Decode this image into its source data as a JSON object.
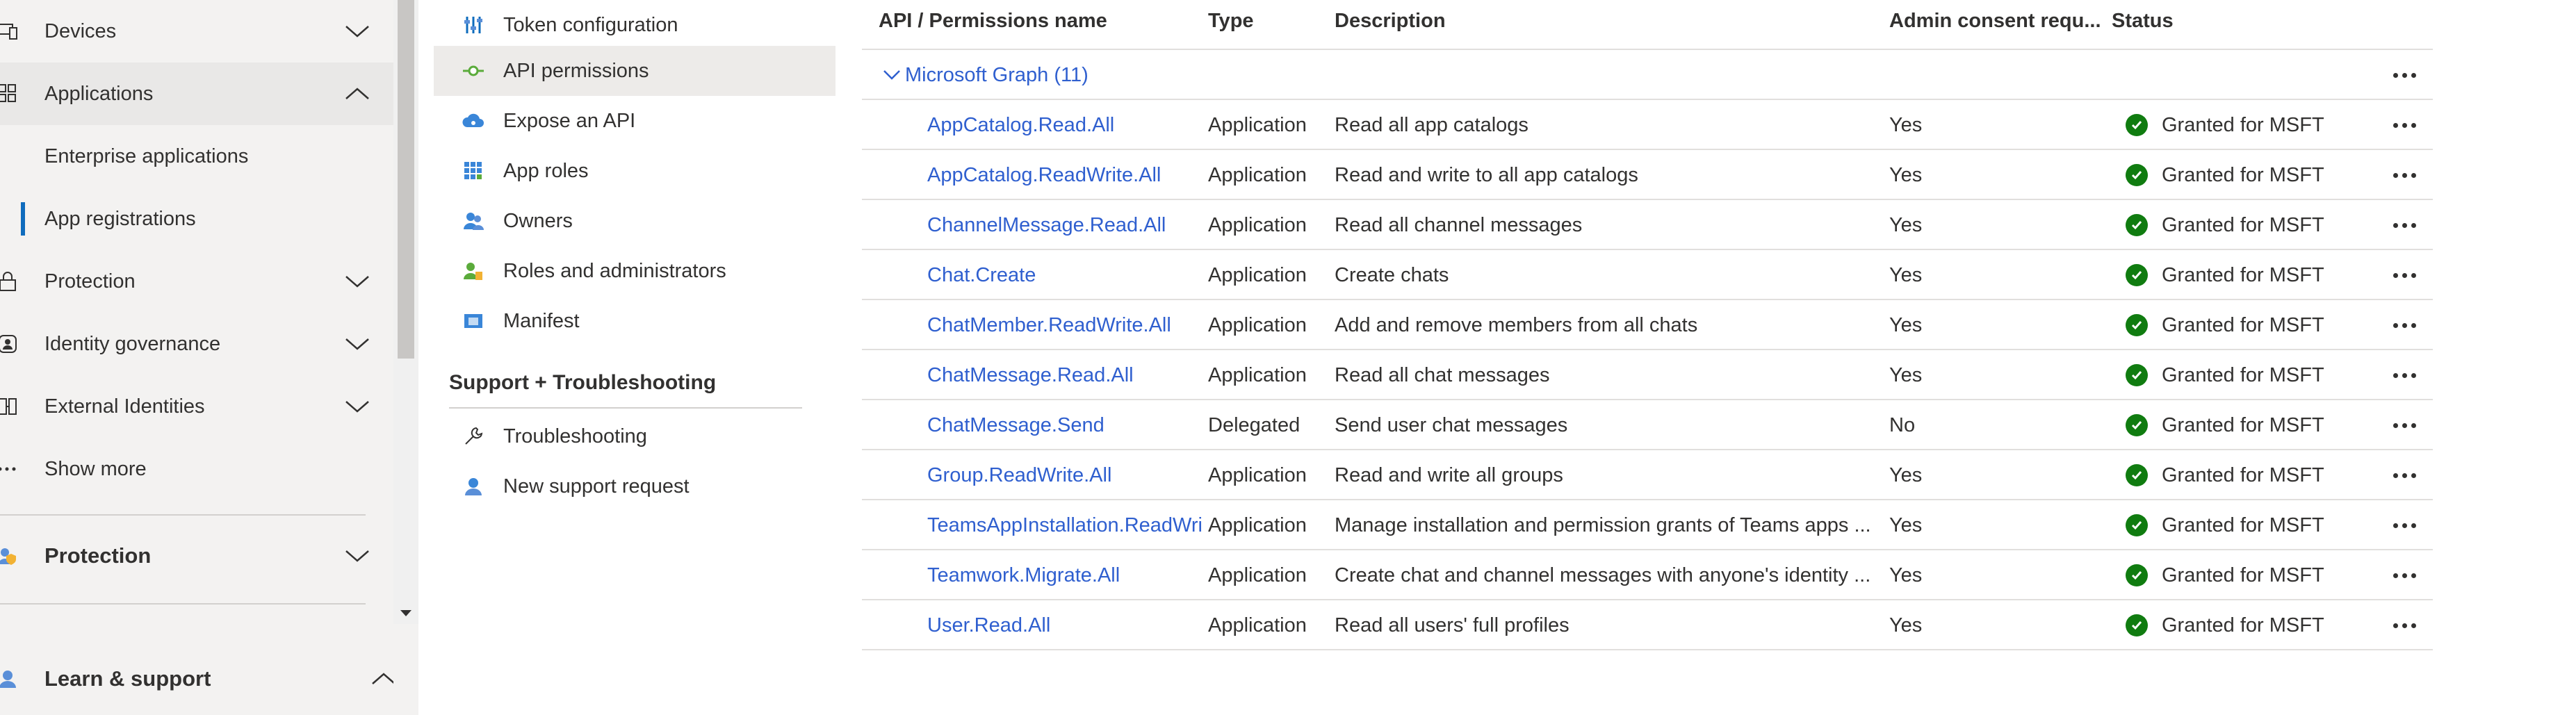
{
  "leftnav": {
    "items": [
      {
        "label": "Devices",
        "icon": "devices-icon",
        "chevron": "down"
      },
      {
        "label": "Applications",
        "icon": "applications-icon",
        "chevron": "up"
      },
      {
        "label": "Enterprise applications"
      },
      {
        "label": "App registrations"
      },
      {
        "label": "Protection",
        "icon": "lock-icon",
        "chevron": "down"
      },
      {
        "label": "Identity governance",
        "icon": "identity-governance-icon",
        "chevron": "down"
      },
      {
        "label": "External Identities",
        "icon": "external-identities-icon",
        "chevron": "down"
      },
      {
        "label": "Show more",
        "icon": "ellipsis-icon"
      },
      {
        "label": "Protection",
        "icon": "protection-icon",
        "chevron": "down"
      },
      {
        "label": "Learn & support",
        "icon": "learn-support-icon",
        "chevron": "up"
      }
    ]
  },
  "midmenu": {
    "items": [
      {
        "label": "Token configuration",
        "icon": "token-configuration-icon"
      },
      {
        "label": "API permissions",
        "icon": "api-permissions-icon"
      },
      {
        "label": "Expose an API",
        "icon": "expose-api-icon"
      },
      {
        "label": "App roles",
        "icon": "app-roles-icon"
      },
      {
        "label": "Owners",
        "icon": "owners-icon"
      },
      {
        "label": "Roles and administrators",
        "icon": "roles-administrators-icon"
      },
      {
        "label": "Manifest",
        "icon": "manifest-icon"
      }
    ],
    "support_section": "Support + Troubleshooting",
    "support_items": [
      {
        "label": "Troubleshooting",
        "icon": "wrench-icon"
      },
      {
        "label": "New support request",
        "icon": "support-person-icon"
      }
    ]
  },
  "table": {
    "headers": {
      "name": "API / Permissions name",
      "type": "Type",
      "description": "Description",
      "admin": "Admin consent requ...",
      "status": "Status"
    },
    "group": "Microsoft Graph (11)",
    "rows": [
      {
        "name": "AppCatalog.Read.All",
        "type": "Application",
        "description": "Read all app catalogs",
        "admin": "Yes",
        "status": "Granted for MSFT"
      },
      {
        "name": "AppCatalog.ReadWrite.All",
        "type": "Application",
        "description": "Read and write to all app catalogs",
        "admin": "Yes",
        "status": "Granted for MSFT"
      },
      {
        "name": "ChannelMessage.Read.All",
        "type": "Application",
        "description": "Read all channel messages",
        "admin": "Yes",
        "status": "Granted for MSFT"
      },
      {
        "name": "Chat.Create",
        "type": "Application",
        "description": "Create chats",
        "admin": "Yes",
        "status": "Granted for MSFT"
      },
      {
        "name": "ChatMember.ReadWrite.All",
        "type": "Application",
        "description": "Add and remove members from all chats",
        "admin": "Yes",
        "status": "Granted for MSFT"
      },
      {
        "name": "ChatMessage.Read.All",
        "type": "Application",
        "description": "Read all chat messages",
        "admin": "Yes",
        "status": "Granted for MSFT"
      },
      {
        "name": "ChatMessage.Send",
        "type": "Delegated",
        "description": "Send user chat messages",
        "admin": "No",
        "status": "Granted for MSFT"
      },
      {
        "name": "Group.ReadWrite.All",
        "type": "Application",
        "description": "Read and write all groups",
        "admin": "Yes",
        "status": "Granted for MSFT"
      },
      {
        "name": "TeamsAppInstallation.ReadWrite",
        "type": "Application",
        "description": "Manage installation and permission grants of Teams apps ...",
        "admin": "Yes",
        "status": "Granted for MSFT"
      },
      {
        "name": "Teamwork.Migrate.All",
        "type": "Application",
        "description": "Create chat and channel messages with anyone's identity ...",
        "admin": "Yes",
        "status": "Granted for MSFT"
      },
      {
        "name": "User.Read.All",
        "type": "Application",
        "description": "Read all users' full profiles",
        "admin": "Yes",
        "status": "Granted for MSFT"
      }
    ]
  },
  "colors": {
    "link": "#2f5fcf",
    "granted": "#107c10",
    "accent": "#0f6cbd"
  }
}
